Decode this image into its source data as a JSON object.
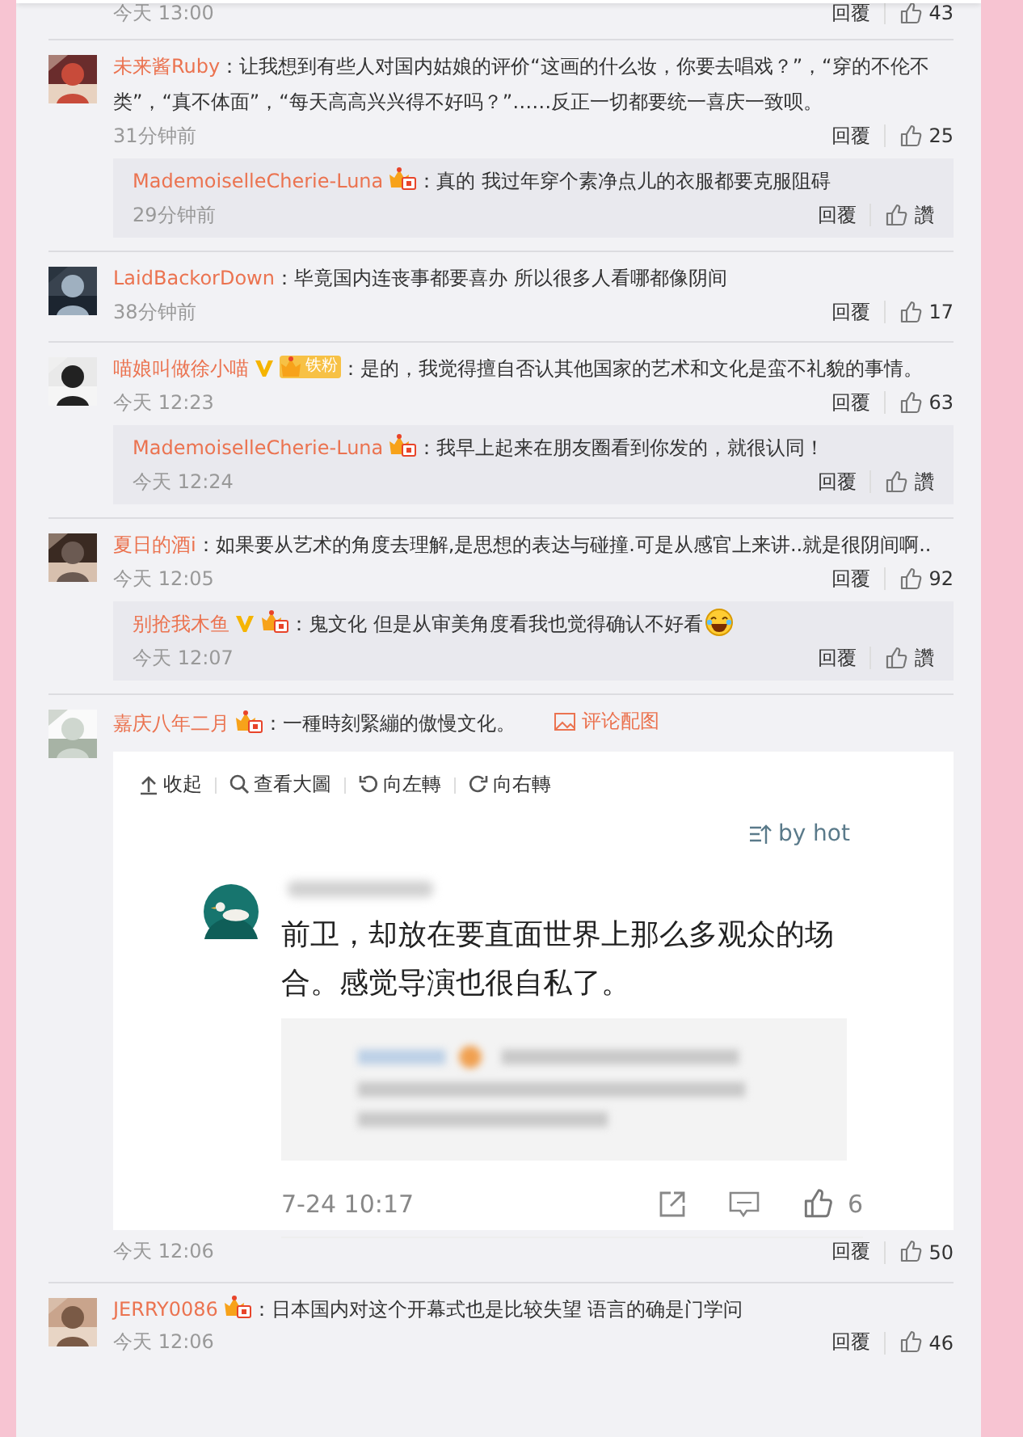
{
  "top_row": {
    "time": "今天 13:00",
    "reply_label": "回覆",
    "likes": "43"
  },
  "comments": [
    {
      "name": "未来酱Ruby",
      "text": "：让我想到有些人对国内姑娘的评价“这画的什么妆，你要去唱戏？”，“穿的不伦不类”，“真不体面”，“每天高高兴兴得不好吗？”……反正一切都要统一喜庆一致呗。",
      "time": "31分钟前",
      "reply_label": "回覆",
      "likes": "25",
      "replies": [
        {
          "name": "MademoiselleCherie-Luna",
          "badges": [
            {
              "kind": "level"
            }
          ],
          "text": "：真的 我过年穿个素净点儿的衣服都要克服阻碍",
          "time": "29分钟前",
          "reply_label": "回覆",
          "likes": "讚"
        }
      ]
    },
    {
      "name": "LaidBackorDown",
      "text": "：毕竟国内连丧事都要喜办 所以很多人看哪都像阴间",
      "time": "38分钟前",
      "reply_label": "回覆",
      "likes": "17"
    },
    {
      "name": "喵娘叫做徐小喵",
      "badges": [
        {
          "kind": "vip"
        },
        {
          "kind": "fan",
          "label": "铁粉"
        }
      ],
      "text": "：是的，我觉得擅自否认其他国家的艺术和文化是蛮不礼貌的事情。",
      "time": "今天 12:23",
      "reply_label": "回覆",
      "likes": "63",
      "replies": [
        {
          "name": "MademoiselleCherie-Luna",
          "badges": [
            {
              "kind": "level"
            }
          ],
          "text": "：我早上起来在朋友圈看到你发的，就很认同！",
          "time": "今天 12:24",
          "reply_label": "回覆",
          "likes": "讚"
        }
      ]
    },
    {
      "name": "夏日的酒i",
      "text": "：如果要从艺术的角度去理解,是思想的表达与碰撞.可是从感官上来讲..就是很阴间啊..",
      "time": "今天 12:05",
      "reply_label": "回覆",
      "likes": "92",
      "replies": [
        {
          "name": "别抢我木鱼",
          "badges": [
            {
              "kind": "vip"
            },
            {
              "kind": "level"
            }
          ],
          "text": "：鬼文化 但是从审美角度看我也觉得确认不好看",
          "emoji": true,
          "time": "今天 12:07",
          "reply_label": "回覆",
          "likes": "讚"
        }
      ]
    },
    {
      "name": "嘉庆八年二月",
      "badges": [
        {
          "kind": "level"
        }
      ],
      "text": "：一種時刻緊繃的傲慢文化。",
      "image_link": "评论配图",
      "image_panel": {
        "tools": [
          "收起",
          "查看大圖",
          "向左轉",
          "向右轉"
        ],
        "sort": "by hot",
        "post_text": "前卫，却放在要直面世界上那么多观众的场合。感觉导演也很自私了。",
        "post_time": "7-24 10:17",
        "post_likes": "6"
      },
      "time": "今天 12:06",
      "reply_label": "回覆",
      "likes": "50"
    },
    {
      "name": "JERRY0086",
      "badges": [
        {
          "kind": "level"
        }
      ],
      "text": "：日本国内对这个开幕式也是比较失望  语言的确是门学问",
      "time": "今天 12:06",
      "reply_label": "回覆",
      "likes": "46"
    }
  ]
}
